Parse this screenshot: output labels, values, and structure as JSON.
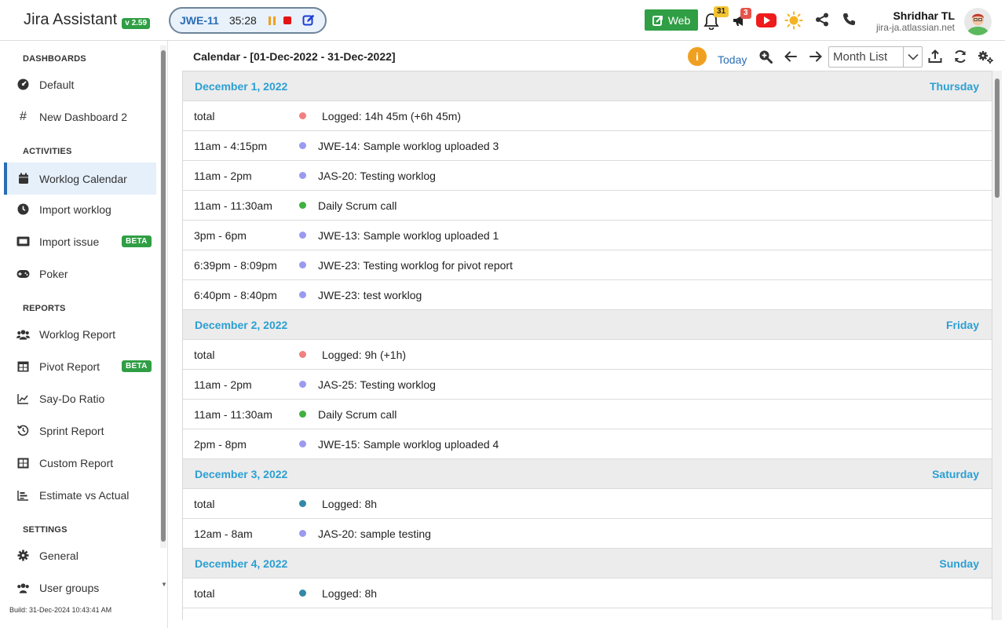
{
  "app": {
    "name": "Jira Assistant",
    "version": "v 2.59"
  },
  "tracker": {
    "issue_key": "JWE-11",
    "elapsed": "35:28"
  },
  "header": {
    "web_label": "Web",
    "notifications_count": "31",
    "announcements_count": "3",
    "user_name": "Shridhar TL",
    "user_site": "jira-ja.atlassian.net"
  },
  "sidebar": {
    "sections": {
      "dashboards": "DASHBOARDS",
      "activities": "ACTIVITIES",
      "reports": "REPORTS",
      "settings": "SETTINGS"
    },
    "items": [
      {
        "label": "Default",
        "icon": "gauge-icon"
      },
      {
        "label": "New Dashboard 2",
        "icon": "hash-icon"
      },
      {
        "label": "Worklog Calendar",
        "icon": "calendar-icon",
        "active": true
      },
      {
        "label": "Import worklog",
        "icon": "clock-icon"
      },
      {
        "label": "Import issue",
        "icon": "ticket-icon",
        "badge": "BETA"
      },
      {
        "label": "Poker",
        "icon": "gamepad-icon"
      },
      {
        "label": "Worklog Report",
        "icon": "users-icon"
      },
      {
        "label": "Pivot Report",
        "icon": "table-icon",
        "badge": "BETA"
      },
      {
        "label": "Say-Do Ratio",
        "icon": "line-chart-icon"
      },
      {
        "label": "Sprint Report",
        "icon": "history-icon"
      },
      {
        "label": "Custom Report",
        "icon": "grid-icon"
      },
      {
        "label": "Estimate vs Actual",
        "icon": "bar-chart-icon"
      },
      {
        "label": "General",
        "icon": "gear-icon"
      },
      {
        "label": "User groups",
        "icon": "users-icon"
      }
    ],
    "build": "Build: 31-Dec-2024 10:43:41 AM"
  },
  "calendar": {
    "title": "Calendar - [01-Dec-2022 - 31-Dec-2022]",
    "today_label": "Today",
    "view": "Month List",
    "colors": {
      "total_red": "#f08080",
      "worklog": "#9a9af0",
      "meeting": "#40b040",
      "total_teal": "#3388a8"
    },
    "days": [
      {
        "date": "December 1, 2022",
        "weekday": "Thursday",
        "events": [
          {
            "time": "total",
            "title": "Logged: 14h 45m (+6h 45m)",
            "color": "#f08080",
            "total": true
          },
          {
            "time": "11am - 4:15pm",
            "title": "JWE-14: Sample worklog uploaded 3",
            "color": "#9a9af0"
          },
          {
            "time": "11am - 2pm",
            "title": "JAS-20: Testing worklog",
            "color": "#9a9af0"
          },
          {
            "time": "11am - 11:30am",
            "title": "Daily Scrum call",
            "color": "#40b040"
          },
          {
            "time": "3pm - 6pm",
            "title": "JWE-13: Sample worklog uploaded 1",
            "color": "#9a9af0"
          },
          {
            "time": "6:39pm - 8:09pm",
            "title": "JWE-23: Testing worklog for pivot report",
            "color": "#9a9af0"
          },
          {
            "time": "6:40pm - 8:40pm",
            "title": "JWE-23: test worklog",
            "color": "#9a9af0"
          }
        ]
      },
      {
        "date": "December 2, 2022",
        "weekday": "Friday",
        "events": [
          {
            "time": "total",
            "title": "Logged: 9h (+1h)",
            "color": "#f08080",
            "total": true
          },
          {
            "time": "11am - 2pm",
            "title": "JAS-25: Testing worklog",
            "color": "#9a9af0"
          },
          {
            "time": "11am - 11:30am",
            "title": "Daily Scrum call",
            "color": "#40b040"
          },
          {
            "time": "2pm - 8pm",
            "title": "JWE-15: Sample worklog uploaded 4",
            "color": "#9a9af0"
          }
        ]
      },
      {
        "date": "December 3, 2022",
        "weekday": "Saturday",
        "events": [
          {
            "time": "total",
            "title": "Logged: 8h",
            "color": "#3388a8",
            "total": true
          },
          {
            "time": "12am - 8am",
            "title": "JAS-20: sample testing",
            "color": "#9a9af0"
          }
        ]
      },
      {
        "date": "December 4, 2022",
        "weekday": "Sunday",
        "events": [
          {
            "time": "total",
            "title": "Logged: 8h",
            "color": "#3388a8",
            "total": true
          }
        ]
      }
    ]
  }
}
